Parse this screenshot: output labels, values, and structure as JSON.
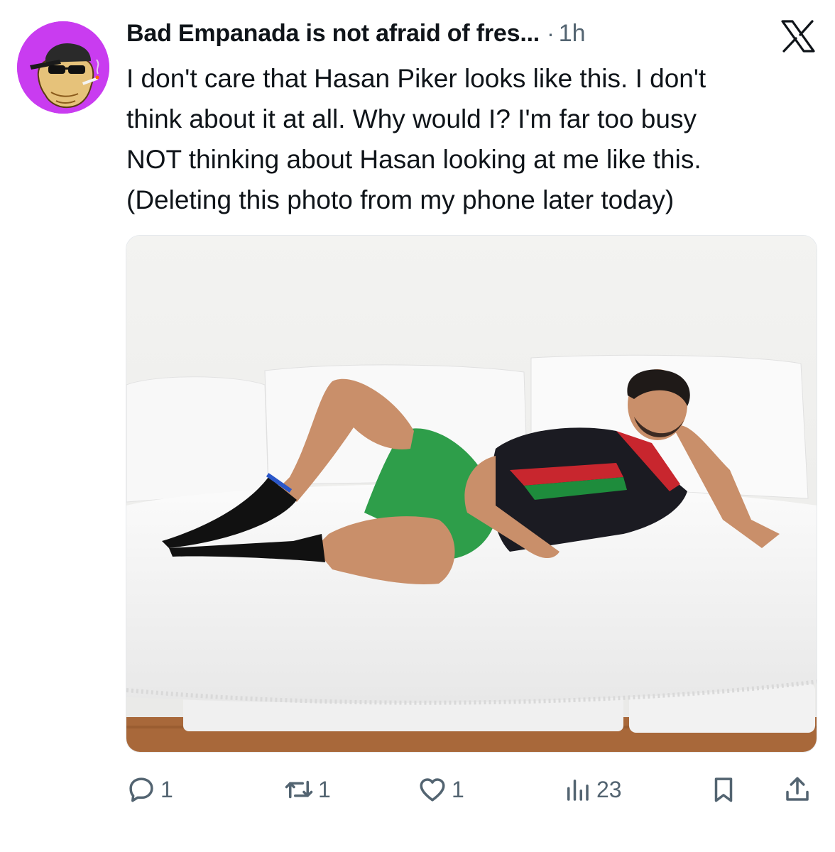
{
  "tweet": {
    "display_name": "Bad Empanada is not afraid of fres...",
    "separator": "·",
    "time": "1h",
    "text": "I don't care that Hasan Piker looks like this. I don't\nthink about it at all. Why would I? I'm far too busy\nNOT thinking about Hasan looking at me like this.\n(Deleting this photo from my phone later today)"
  },
  "avatar": {
    "background_color": "#c93cf0",
    "icon": "empanada-character-avatar"
  },
  "brand": {
    "icon": "x-logo-icon"
  },
  "media": {
    "icon": "photo-man-on-white-sofa"
  },
  "actions": {
    "reply_count": "1",
    "retweet_count": "1",
    "like_count": "1",
    "views_count": "23"
  },
  "colors": {
    "text": "#0f1419",
    "secondary": "#536471"
  }
}
